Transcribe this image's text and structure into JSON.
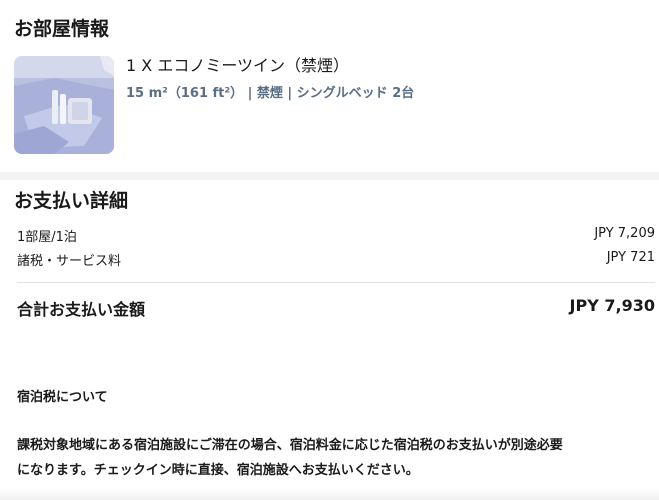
{
  "room_section": {
    "title": "お部屋情報",
    "room_name": "1 X エコノミーツイン（禁煙）",
    "room_details": "15 m²（161 ft²） | 禁煙 | シングルベッド 2台"
  },
  "payment_section": {
    "title": "お支払い詳細",
    "lines": [
      {
        "label": "1部屋/1泊",
        "value": "JPY 7,209"
      },
      {
        "label": "諸税・サービス料",
        "value": "JPY 721"
      }
    ],
    "total": {
      "label": "合計お支払い金額",
      "value": "JPY 7,930"
    }
  },
  "tax_notice": {
    "heading": "宿泊税について",
    "body_lines": [
      "課税対象地域にある宿泊施設にご滞在の場合、宿泊料金に応じた宿泊税のお支払いが別途必要",
      "になります。チェックイン時に直接、宿泊施設へお支払いください。"
    ]
  },
  "colors": {
    "details_text": "#5a6e86",
    "background_band": "#f3f3f3"
  }
}
